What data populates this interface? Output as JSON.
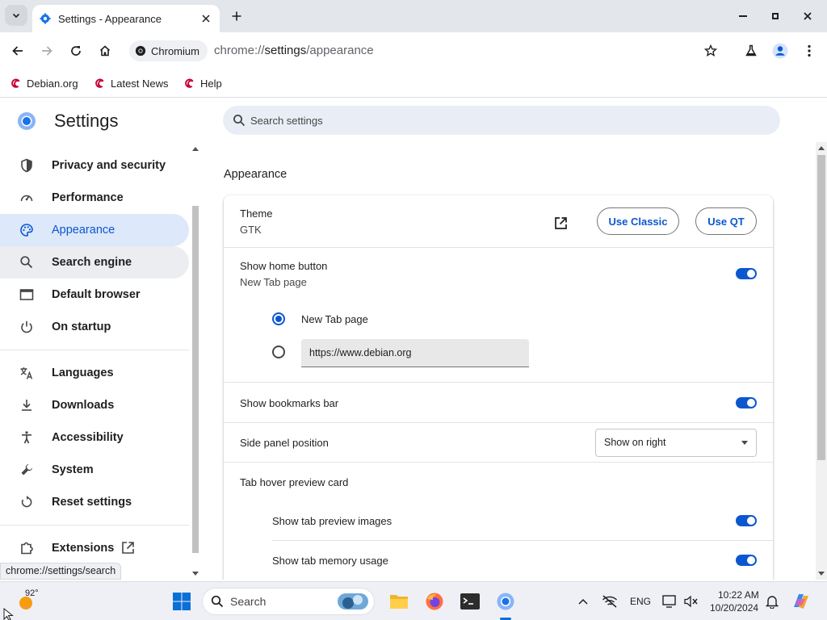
{
  "browser": {
    "tab_title": "Settings - Appearance",
    "site_chip": "Chromium",
    "url_scheme": "chrome://",
    "url_host": "settings",
    "url_path": "/appearance",
    "bookmarks": [
      {
        "label": "Debian.org"
      },
      {
        "label": "Latest News"
      },
      {
        "label": "Help"
      }
    ],
    "status_url": "chrome://settings/search"
  },
  "settings": {
    "title": "Settings",
    "search_placeholder": "Search settings",
    "nav": [
      {
        "label": "Privacy and security",
        "icon": "shield-icon"
      },
      {
        "label": "Performance",
        "icon": "speedometer-icon"
      },
      {
        "label": "Appearance",
        "icon": "palette-icon"
      },
      {
        "label": "Search engine",
        "icon": "search-icon"
      },
      {
        "label": "Default browser",
        "icon": "browser-window-icon"
      },
      {
        "label": "On startup",
        "icon": "power-icon"
      },
      {
        "label": "Languages",
        "icon": "translate-icon"
      },
      {
        "label": "Downloads",
        "icon": "download-icon"
      },
      {
        "label": "Accessibility",
        "icon": "accessibility-icon"
      },
      {
        "label": "System",
        "icon": "wrench-icon"
      },
      {
        "label": "Reset settings",
        "icon": "reset-icon"
      },
      {
        "label": "Extensions",
        "icon": "puzzle-icon"
      }
    ],
    "active_nav": "Appearance"
  },
  "appearance": {
    "section_title": "Appearance",
    "theme": {
      "label": "Theme",
      "value": "GTK",
      "use_classic": "Use Classic",
      "use_qt": "Use QT"
    },
    "home_button": {
      "label": "Show home button",
      "value": "New Tab page",
      "enabled": true,
      "option_new_tab": "New Tab page",
      "option_url": "https://www.debian.org"
    },
    "bookmarks_bar": {
      "label": "Show bookmarks bar",
      "enabled": true
    },
    "side_panel": {
      "label": "Side panel position",
      "selected": "Show on right"
    },
    "tab_hover": {
      "label": "Tab hover preview card",
      "preview_images": {
        "label": "Show tab preview images",
        "enabled": true
      },
      "memory_usage": {
        "label": "Show tab memory usage",
        "enabled": true
      }
    }
  },
  "taskbar": {
    "weather_temp": "92°",
    "search_label": "Search",
    "language": "ENG",
    "time": "10:22 AM",
    "date": "10/20/2024"
  },
  "colors": {
    "accent": "#0b57d0",
    "active_nav_bg": "#dde8fa",
    "search_bg": "#e9eef6"
  }
}
